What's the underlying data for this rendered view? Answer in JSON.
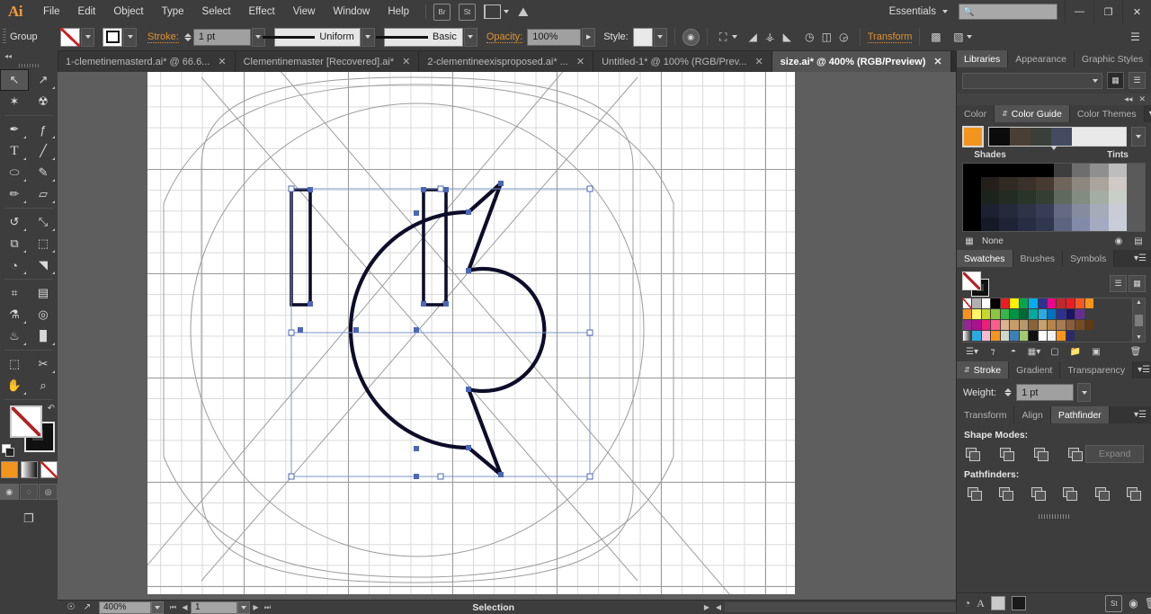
{
  "app": {
    "name": "Adobe Illustrator",
    "logo": "Ai"
  },
  "menubar": {
    "items": [
      "File",
      "Edit",
      "Object",
      "Type",
      "Select",
      "Effect",
      "View",
      "Window",
      "Help"
    ],
    "bridge_label": "Br",
    "stock_label": "St",
    "workspace": "Essentials",
    "search_placeholder": "",
    "window_buttons": {
      "minimize": "—",
      "restore": "❐",
      "close": "✕"
    }
  },
  "controlbar": {
    "selection_label": "Group",
    "fill_label": "Fill",
    "stroke_label": "Stroke:",
    "stroke_weight": "1 pt",
    "variable_width_profile": "Uniform",
    "brush_definition": "Basic",
    "opacity_label": "Opacity:",
    "opacity_value": "100%",
    "style_label": "Style:",
    "transform_label": "Transform",
    "recolor_tooltip": "Recolor Artwork",
    "align_tooltip": "Align"
  },
  "tabs": [
    {
      "title": "1-clemetinemasterd.ai* @ 66.6...",
      "active": false
    },
    {
      "title": "Clementinemaster [Recovered].ai*",
      "active": false
    },
    {
      "title": "2-clementineexisproposed.ai* ...",
      "active": false
    },
    {
      "title": "Untitled-1* @ 100% (RGB/Prev...",
      "active": false
    },
    {
      "title": "size.ai* @ 400% (RGB/Preview)",
      "active": true
    }
  ],
  "toolbar": {
    "tools": [
      {
        "name": "selection-tool",
        "glyph": "↖",
        "selected": true,
        "corner": false
      },
      {
        "name": "direct-selection-tool",
        "glyph": "↗",
        "selected": false,
        "corner": true
      },
      {
        "name": "magic-wand-tool",
        "glyph": "✶",
        "selected": false,
        "corner": false
      },
      {
        "name": "lasso-tool",
        "glyph": "☢",
        "selected": false,
        "corner": false
      },
      {
        "name": "pen-tool",
        "glyph": "✒",
        "selected": false,
        "corner": true
      },
      {
        "name": "curvature-tool",
        "glyph": "ƒ",
        "selected": false,
        "corner": true
      },
      {
        "name": "type-tool",
        "glyph": "T",
        "selected": false,
        "corner": true
      },
      {
        "name": "line-segment-tool",
        "glyph": "╱",
        "selected": false,
        "corner": true
      },
      {
        "name": "ellipse-tool",
        "glyph": "⬭",
        "selected": false,
        "corner": true
      },
      {
        "name": "paintbrush-tool",
        "glyph": "✎",
        "selected": false,
        "corner": true
      },
      {
        "name": "pencil-tool",
        "glyph": "✏",
        "selected": false,
        "corner": true
      },
      {
        "name": "eraser-tool",
        "glyph": "▱",
        "selected": false,
        "corner": true
      },
      {
        "name": "rotate-tool",
        "glyph": "↺",
        "selected": false,
        "corner": true
      },
      {
        "name": "scale-tool",
        "glyph": "⤡",
        "selected": false,
        "corner": true
      },
      {
        "name": "width-tool",
        "glyph": "⧉",
        "selected": false,
        "corner": true
      },
      {
        "name": "free-transform-tool",
        "glyph": "⬚",
        "selected": false,
        "corner": true
      },
      {
        "name": "shape-builder-tool",
        "glyph": "◔",
        "selected": false,
        "corner": true
      },
      {
        "name": "perspective-grid-tool",
        "glyph": "◥",
        "selected": false,
        "corner": true
      },
      {
        "name": "mesh-tool",
        "glyph": "⌗",
        "selected": false,
        "corner": false
      },
      {
        "name": "gradient-tool",
        "glyph": "▤",
        "selected": false,
        "corner": false
      },
      {
        "name": "eyedropper-tool",
        "glyph": "⚗",
        "selected": false,
        "corner": true
      },
      {
        "name": "blend-tool",
        "glyph": "◎",
        "selected": false,
        "corner": false
      },
      {
        "name": "symbol-sprayer-tool",
        "glyph": "♨",
        "selected": false,
        "corner": true
      },
      {
        "name": "column-graph-tool",
        "glyph": "█",
        "selected": false,
        "corner": true
      },
      {
        "name": "artboard-tool",
        "glyph": "⬚",
        "selected": false,
        "corner": false
      },
      {
        "name": "slice-tool",
        "glyph": "✂",
        "selected": false,
        "corner": true
      },
      {
        "name": "hand-tool",
        "glyph": "✋",
        "selected": false,
        "corner": true
      },
      {
        "name": "zoom-tool",
        "glyph": "⌕",
        "selected": false,
        "corner": false
      }
    ],
    "fill_color": "none",
    "stroke_color": "#111111",
    "color_modes": [
      "color",
      "gradient",
      "none"
    ],
    "draw_modes": [
      "draw-normal",
      "draw-behind",
      "draw-inside"
    ],
    "screen_mode": "change-screen-mode"
  },
  "canvas": {
    "zoom": "400%",
    "artboard_number": "1",
    "status_text": "Selection",
    "grid_color": "#d9d9d9",
    "guide_color": "#9a9a9a",
    "selection_color": "#4c68b5",
    "artwork_description": "Letter C logo outline with vertical bars"
  },
  "panels": {
    "top_group": {
      "tabs": [
        "Libraries",
        "Appearance",
        "Graphic Styles"
      ],
      "active": "Libraries",
      "library_select_value": "",
      "view_modes": [
        "grid-view",
        "list-view"
      ]
    },
    "color_guide": {
      "tabs": [
        "Color",
        "Color Guide",
        "Color Themes"
      ],
      "active": "Color Guide",
      "base_color": "#f2951f",
      "harmony_colors": [
        "#0b0b0b",
        "#4a3f35",
        "#3a4039",
        "#454a63"
      ],
      "shades_label": "Shades",
      "tints_label": "Tints",
      "variations_label": "None",
      "grid_rows": [
        [
          "#000000",
          "#000000",
          "#000000",
          "#000000",
          "#000000",
          "#3e3e3e",
          "#6e6e6e",
          "#8f8f8f",
          "#b9b9b9",
          "#d8d8d8"
        ],
        [
          "#000000",
          "#241f1b",
          "#312a23",
          "#3a312a",
          "#473b31",
          "#6f655b",
          "#8e8780",
          "#aba49d",
          "#cfcac5",
          "#e8e5e2"
        ],
        [
          "#000000",
          "#1c231c",
          "#222c22",
          "#2a352a",
          "#333f33",
          "#5e6a5e",
          "#828d82",
          "#a3ada3",
          "#c8cfc8",
          "#e4e8e4"
        ],
        [
          "#000000",
          "#1d2030",
          "#25293c",
          "#2e3348",
          "#373d55",
          "#636a82",
          "#868ca0",
          "#a6abb9",
          "#c9ccd6",
          "#e6e7ec"
        ],
        [
          "#000000",
          "#161a26",
          "#1e2435",
          "#272d42",
          "#303850",
          "#5c6480",
          "#828 aa",
          "#a4abc0",
          "#c8cdd9",
          "#e7e9ef"
        ]
      ]
    },
    "swatches": {
      "tabs": [
        "Swatches",
        "Brushes",
        "Symbols"
      ],
      "active": "Swatches",
      "view_modes": [
        "list-view",
        "grid-view"
      ],
      "colors": [
        "none",
        "registration",
        "#ffffff",
        "#000000",
        "#ed1c24",
        "#fff200",
        "#00a651",
        "#00aeef",
        "#2e3192",
        "#ec008c",
        "#c1272d",
        "#ed1c24",
        "#f15a24",
        "#f7941e",
        "#3d3d3d",
        "#3d3d3d",
        "#3d3d3d",
        "#3d3d3d",
        "#f7941e",
        "#fff568",
        "#c5d92d",
        "#8cc63f",
        "#39b54a",
        "#009245",
        "#006837",
        "#00a99d",
        "#29abe2",
        "#0071bc",
        "#2e3192",
        "#1b1464",
        "#662d91",
        "#3d3d3d",
        "#3d3d3d",
        "#3d3d3d",
        "#3d3d3d",
        "#3d3d3d",
        "#93278f",
        "#a9128e",
        "#ed1e79",
        "#ff5b8d",
        "#d9b48f",
        "#c69c6d",
        "#b6986b",
        "#8c6239",
        "#c9a06c",
        "#b5854b",
        "#a67c52",
        "#8a5e3c",
        "#754c24",
        "#603813",
        "#3d3d3d",
        "#3d3d3d",
        "#3d3d3d",
        "#3d3d3d",
        "#e6e6e6",
        "#29abe2",
        "#f7b8d0",
        "#f7941e",
        "#cfd8c8",
        "#3d7fb8",
        "#a5c96b",
        "#111111",
        "#ffffff",
        "#f2f2f2",
        "#f7941e",
        "#2b2b6b",
        "#3d3d3d",
        "#3d3d3d",
        "#3d3d3d",
        "#3d3d3d",
        "#3d3d3d",
        "#3d3d3d"
      ],
      "footer_icons": [
        "swatch-libraries",
        "color-group-link",
        "show-swatch-kinds",
        "new-color-group",
        "new-swatch",
        "delete-swatch"
      ]
    },
    "stroke": {
      "tabs": [
        "Stroke",
        "Gradient",
        "Transparency"
      ],
      "active": "Stroke",
      "weight_label": "Weight:",
      "weight_value": "1 pt"
    },
    "pathfinder": {
      "tabs": [
        "Transform",
        "Align",
        "Pathfinder"
      ],
      "active": "Pathfinder",
      "shape_modes_label": "Shape Modes:",
      "shape_mode_buttons": [
        "unite",
        "minus-front",
        "intersect",
        "exclude"
      ],
      "expand_label": "Expand",
      "pathfinders_label": "Pathfinders:",
      "pathfinder_buttons": [
        "divide",
        "trim",
        "merge",
        "crop",
        "outline",
        "minus-back"
      ]
    },
    "footer_icons": [
      "ai-file-icon",
      "type-icon",
      "light-swatch",
      "dark-swatch",
      "stock-icon",
      "cc-libraries-icon",
      "trash-icon"
    ]
  },
  "statusbar": {
    "zoom_value": "400%",
    "artboard_value": "1",
    "status_text": "Selection"
  }
}
